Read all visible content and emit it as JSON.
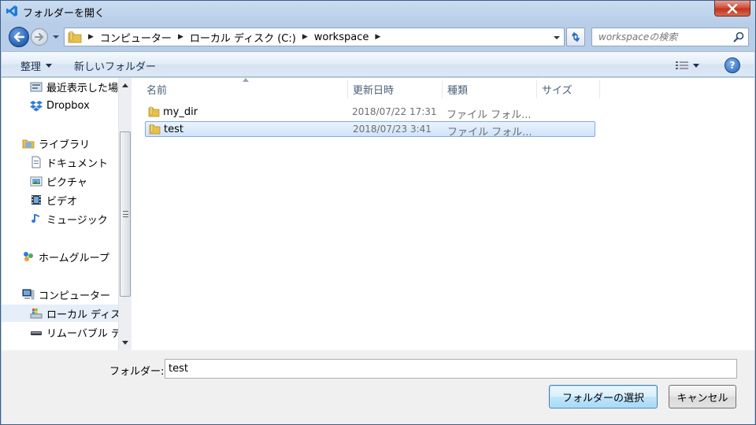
{
  "window": {
    "title": "フォルダーを開く"
  },
  "address": {
    "crumbs": [
      "コンピューター",
      "ローカル ディスク (C:)",
      "workspace"
    ]
  },
  "search": {
    "placeholder": "workspaceの検索"
  },
  "toolbar": {
    "organize": "整理",
    "new_folder": "新しいフォルダー",
    "help": "?"
  },
  "nav": {
    "items": [
      {
        "label": "最近表示した場所",
        "icon": "recent-places-icon"
      },
      {
        "label": "Dropbox",
        "icon": "dropbox-icon"
      },
      {
        "label": "ライブラリ",
        "icon": "library-icon"
      },
      {
        "label": "ドキュメント",
        "icon": "documents-icon"
      },
      {
        "label": "ピクチャ",
        "icon": "pictures-icon"
      },
      {
        "label": "ビデオ",
        "icon": "videos-icon"
      },
      {
        "label": "ミュージック",
        "icon": "music-icon"
      },
      {
        "label": "ホームグループ",
        "icon": "homegroup-icon"
      },
      {
        "label": "コンピューター",
        "icon": "computer-icon"
      },
      {
        "label": "ローカル ディスク (C:)",
        "icon": "local-disk-icon"
      },
      {
        "label": "リムーバブル ディスク",
        "icon": "removable-disk-icon"
      }
    ]
  },
  "list": {
    "columns": [
      "名前",
      "更新日時",
      "種類",
      "サイズ"
    ],
    "rows": [
      {
        "name": "my_dir",
        "date": "2018/07/22 17:31",
        "type": "ファイル フォル...",
        "size": ""
      },
      {
        "name": "test",
        "date": "2018/07/23 3:41",
        "type": "ファイル フォル...",
        "size": ""
      }
    ]
  },
  "folder_field": {
    "label": "フォルダー:",
    "value": "test"
  },
  "buttons": {
    "select": "フォルダーの選択",
    "cancel": "キャンセル"
  },
  "colors": {
    "accent": "#3c7fb1",
    "selection": "#cfe3fb",
    "folder": "#e8c04a"
  }
}
